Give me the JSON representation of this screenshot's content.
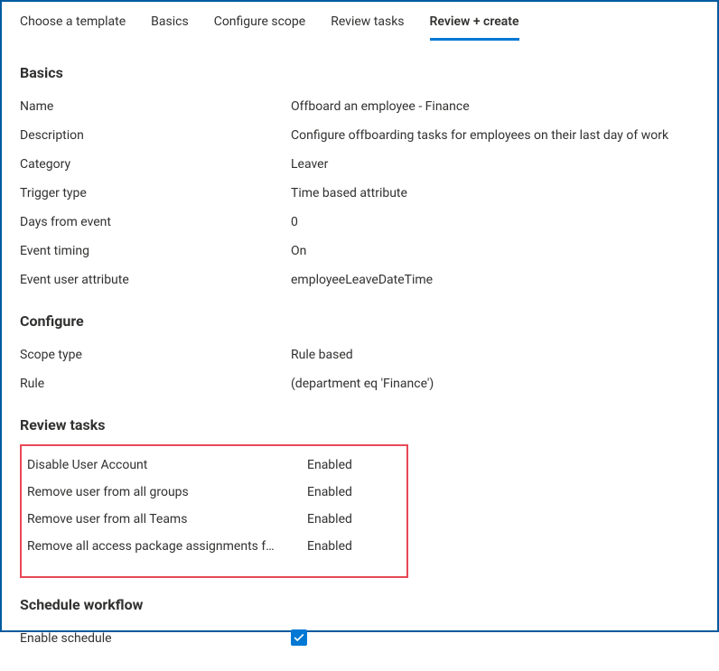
{
  "tabs": {
    "choose_template": "Choose a template",
    "basics": "Basics",
    "configure_scope": "Configure scope",
    "review_tasks": "Review tasks",
    "review_create": "Review + create"
  },
  "sections": {
    "basics": {
      "heading": "Basics",
      "name_label": "Name",
      "name_value": "Offboard an employee - Finance",
      "description_label": "Description",
      "description_value": "Configure offboarding tasks for employees on their last day of work",
      "category_label": "Category",
      "category_value": "Leaver",
      "trigger_type_label": "Trigger type",
      "trigger_type_value": "Time based attribute",
      "days_from_event_label": "Days from event",
      "days_from_event_value": "0",
      "event_timing_label": "Event timing",
      "event_timing_value": "On",
      "event_user_attribute_label": "Event user attribute",
      "event_user_attribute_value": "employeeLeaveDateTime"
    },
    "configure": {
      "heading": "Configure",
      "scope_type_label": "Scope type",
      "scope_type_value": "Rule based",
      "rule_label": "Rule",
      "rule_value": " (department eq 'Finance')"
    },
    "review_tasks": {
      "heading": "Review tasks",
      "tasks": [
        {
          "label": "Disable User Account",
          "status": "Enabled"
        },
        {
          "label": "Remove user from all groups",
          "status": "Enabled"
        },
        {
          "label": "Remove user from all Teams",
          "status": "Enabled"
        },
        {
          "label": "Remove all access package assignments f…",
          "status": "Enabled"
        }
      ]
    },
    "schedule": {
      "heading": "Schedule workflow",
      "enable_label": "Enable schedule",
      "enable_checked": true
    }
  }
}
